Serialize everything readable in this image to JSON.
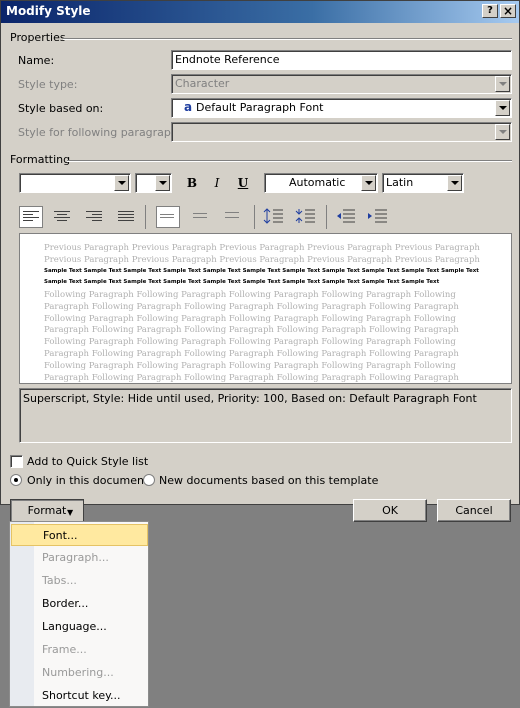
{
  "window": {
    "title": "Modify Style",
    "help_btn": "?",
    "close_btn": "×"
  },
  "properties": {
    "label": "Properties",
    "name_label": "Name:",
    "name_value": "Endnote Reference",
    "style_type_label": "Style type:",
    "style_type_value": "Character",
    "based_on_label": "Style based on:",
    "based_on_icon": "a",
    "based_on_value": "Default Paragraph Font",
    "following_label": "Style for following paragraph:",
    "following_value": ""
  },
  "formatting": {
    "label": "Formatting",
    "font_value": "",
    "size_value": "",
    "bold": "B",
    "italic": "I",
    "underline": "U",
    "color_value": "Automatic",
    "script_value": "Latin"
  },
  "preview": {
    "previous": "Previous Paragraph Previous Paragraph Previous Paragraph Previous Paragraph Previous Paragraph Previous Paragraph Previous Paragraph Previous Paragraph Previous Paragraph Previous Paragraph",
    "sample": "Sample Text Sample Text Sample Text Sample Text Sample Text Sample Text Sample Text Sample Text Sample Text Sample Text Sample Text Sample Text Sample Text Sample Text Sample Text Sample Text Sample Text Sample Text Sample Text Sample Text Sample Text",
    "following": "Following Paragraph Following Paragraph Following Paragraph Following Paragraph Following Paragraph Following Paragraph Following Paragraph Following Paragraph Following Paragraph Following Paragraph Following Paragraph Following Paragraph Following Paragraph Following Paragraph Following Paragraph Following Paragraph Following Paragraph Following Paragraph Following Paragraph Following Paragraph Following Paragraph Following Paragraph Following Paragraph Following Paragraph Following Paragraph Following Paragraph Following Paragraph Following Paragraph Following Paragraph Following Paragraph Following Paragraph Following Paragraph Following Paragraph Following Paragraph Following Paragraph Following Paragraph Following Paragraph Following Paragraph Following Paragraph Following Paragraph Following Paragraph"
  },
  "description": "Superscript, Style: Hide until used, Priority: 100, Based on: Default Paragraph Font",
  "options": {
    "quick_style": "Add to Quick Style list",
    "only_doc": "Only in this document",
    "new_docs": "New documents based on this template"
  },
  "buttons": {
    "format": "Format",
    "ok": "OK",
    "cancel": "Cancel"
  },
  "menu": [
    {
      "label": "Font...",
      "enabled": true
    },
    {
      "label": "Paragraph...",
      "enabled": false
    },
    {
      "label": "Tabs...",
      "enabled": false
    },
    {
      "label": "Border...",
      "enabled": true
    },
    {
      "label": "Language...",
      "enabled": true
    },
    {
      "label": "Frame...",
      "enabled": false
    },
    {
      "label": "Numbering...",
      "enabled": false
    },
    {
      "label": "Shortcut key...",
      "enabled": true
    }
  ]
}
